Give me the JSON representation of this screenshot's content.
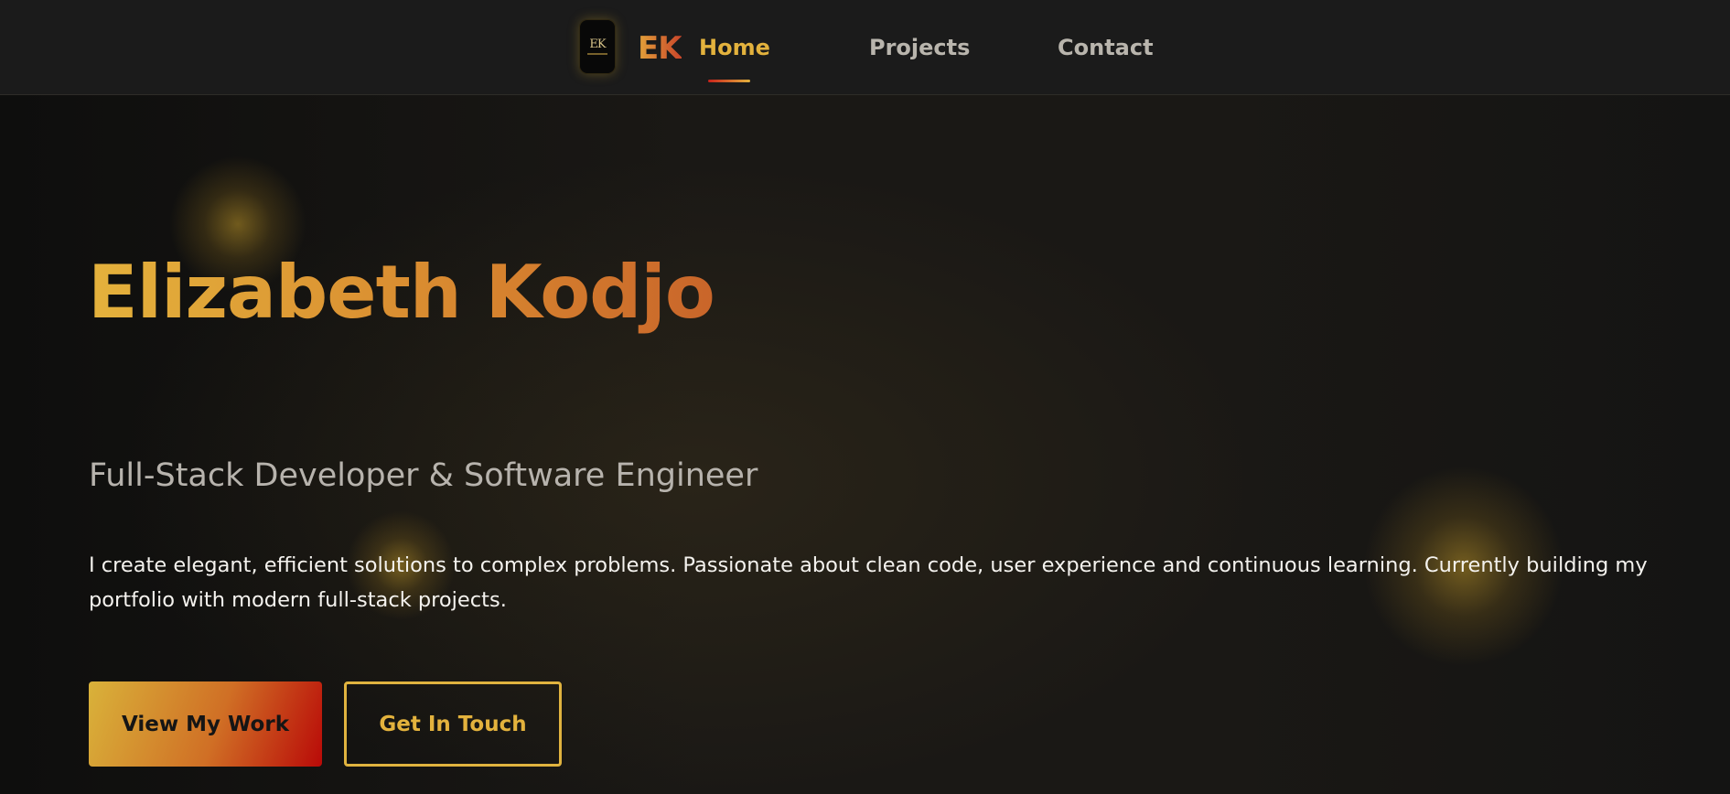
{
  "nav": {
    "logo_monogram": "EK",
    "brand": "EK",
    "links": [
      {
        "label": "Home",
        "active": true
      },
      {
        "label": "Projects",
        "active": false
      },
      {
        "label": "Contact",
        "active": false
      }
    ]
  },
  "hero": {
    "name": "Elizabeth Kodjo",
    "subtitle": "Full-Stack Developer & Software Engineer",
    "description": "I create elegant, efficient solutions to complex problems. Passionate about clean code, user experience and continuous learning. Currently building my portfolio with modern full-stack projects.",
    "primary_button": "View My Work",
    "secondary_button": "Get In Touch"
  },
  "colors": {
    "accent_gold": "#e3b23d",
    "accent_red": "#b90a08",
    "background": "#131312",
    "nav_background": "#1b1b1b",
    "text_muted": "#b7b3ad"
  }
}
